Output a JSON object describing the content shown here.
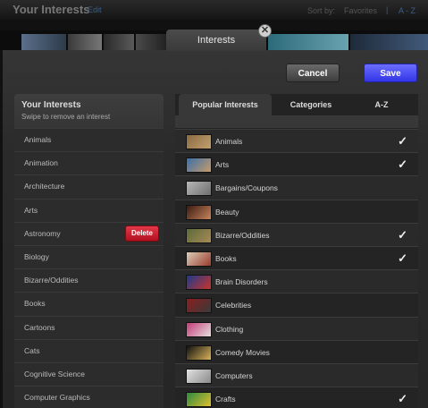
{
  "header": {
    "title": "Your Interests",
    "edit_label": "Edit",
    "sort_by_label": "Sort by:",
    "sort_favorites": "Favorites",
    "sort_separator": "|",
    "sort_az": "A - Z"
  },
  "modal": {
    "title": "Interests",
    "close_glyph": "✕",
    "cancel_label": "Cancel",
    "save_label": "Save"
  },
  "left_panel": {
    "heading": "Your Interests",
    "subheading": "Swipe to remove an interest",
    "delete_label": "Delete",
    "items": [
      "Animals",
      "Animation",
      "Architecture",
      "Arts",
      "Astronomy",
      "Biology",
      "Bizarre/Oddities",
      "Books",
      "Cartoons",
      "Cats",
      "Cognitive Science",
      "Computer Graphics"
    ]
  },
  "right_panel": {
    "tabs": [
      "Popular Interests",
      "Categories",
      "A-Z"
    ],
    "active_tab": "Popular Interests",
    "check_glyph": "✓",
    "items": [
      {
        "label": "Animals",
        "checked": true,
        "thumb_colors": [
          "#8a6a43",
          "#c2a06d"
        ]
      },
      {
        "label": "Arts",
        "checked": true,
        "thumb_colors": [
          "#3a6fa8",
          "#c79b6d"
        ]
      },
      {
        "label": "Bargains/Coupons",
        "checked": false,
        "thumb_colors": [
          "#b7b7b7",
          "#6e6e6e"
        ]
      },
      {
        "label": "Beauty",
        "checked": false,
        "thumb_colors": [
          "#3a1a10",
          "#c9855e"
        ]
      },
      {
        "label": "Bizarre/Oddities",
        "checked": true,
        "thumb_colors": [
          "#5b6a3a",
          "#a88a55"
        ]
      },
      {
        "label": "Books",
        "checked": true,
        "thumb_colors": [
          "#d9cdb8",
          "#9b3b2b"
        ]
      },
      {
        "label": "Brain Disorders",
        "checked": false,
        "thumb_colors": [
          "#1d3a8a",
          "#c7342c"
        ]
      },
      {
        "label": "Celebrities",
        "checked": false,
        "thumb_colors": [
          "#8a1e1e",
          "#3a3a3a"
        ]
      },
      {
        "label": "Clothing",
        "checked": false,
        "thumb_colors": [
          "#c23c7a",
          "#e7e0dc"
        ]
      },
      {
        "label": "Comedy Movies",
        "checked": false,
        "thumb_colors": [
          "#111111",
          "#d9b35a"
        ]
      },
      {
        "label": "Computers",
        "checked": false,
        "thumb_colors": [
          "#e2e2e2",
          "#8a8a8a"
        ]
      },
      {
        "label": "Crafts",
        "checked": true,
        "thumb_colors": [
          "#2b8a3e",
          "#e0c030"
        ]
      }
    ]
  }
}
